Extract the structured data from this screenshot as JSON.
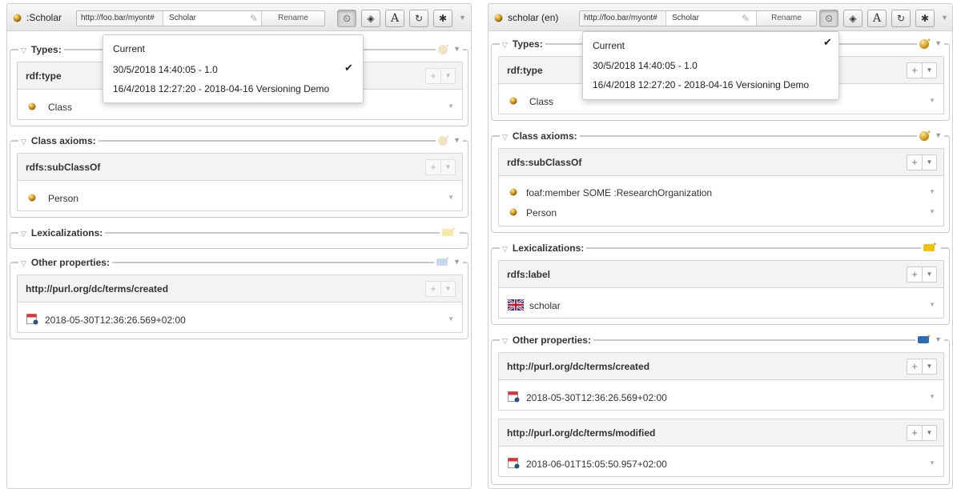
{
  "left": {
    "header": {
      "title": ":Scholar",
      "namespace": "http://foo.bar/myont#",
      "local_name": "Scholar",
      "rename_label": "Rename",
      "font_button": "A"
    },
    "history_menu": {
      "items": [
        {
          "label": "Current",
          "checked": false
        },
        {
          "label": "30/5/2018 14:40:05 - 1.0",
          "checked": true
        },
        {
          "label": "16/4/2018 12:27:20 - 2018-04-16 Versioning Demo",
          "checked": false
        }
      ]
    },
    "sections": {
      "types": {
        "title": "Types:",
        "property": "rdf:type",
        "values": [
          {
            "text": "Class"
          }
        ]
      },
      "class_axioms": {
        "title": "Class axioms:",
        "property": "rdfs:subClassOf",
        "values": [
          {
            "text": "Person"
          }
        ]
      },
      "lexicalizations": {
        "title": "Lexicalizations:"
      },
      "other_properties": {
        "title": "Other properties:",
        "properties": [
          {
            "name": "http://purl.org/dc/terms/created",
            "values": [
              {
                "text": "2018-05-30T12:36:26.569+02:00"
              }
            ]
          }
        ]
      }
    }
  },
  "right": {
    "header": {
      "title": "scholar (en)",
      "namespace": "http://foo.bar/myont#",
      "local_name": "Scholar",
      "rename_label": "Rename",
      "font_button": "A"
    },
    "history_menu": {
      "items": [
        {
          "label": "Current",
          "checked": true
        },
        {
          "label": "30/5/2018 14:40:05 - 1.0",
          "checked": false
        },
        {
          "label": "16/4/2018 12:27:20 - 2018-04-16 Versioning Demo",
          "checked": false
        }
      ]
    },
    "sections": {
      "types": {
        "title": "Types:",
        "property": "rdf:type",
        "values": [
          {
            "text": "Class"
          }
        ]
      },
      "class_axioms": {
        "title": "Class axioms:",
        "property": "rdfs:subClassOf",
        "values": [
          {
            "text": "foaf:member SOME :ResearchOrganization"
          },
          {
            "text": "Person"
          }
        ]
      },
      "lexicalizations": {
        "title": "Lexicalizations:",
        "property": "rdfs:label",
        "values": [
          {
            "text": "scholar",
            "flag": "uk-flag"
          }
        ]
      },
      "other_properties": {
        "title": "Other properties:",
        "properties": [
          {
            "name": "http://purl.org/dc/terms/created",
            "values": [
              {
                "text": "2018-05-30T12:36:26.569+02:00"
              }
            ]
          },
          {
            "name": "http://purl.org/dc/terms/modified",
            "values": [
              {
                "text": "2018-06-01T15:05:50.957+02:00"
              }
            ]
          }
        ]
      }
    }
  },
  "icons": {
    "resource": "class-ball-icon",
    "history": "history-icon",
    "hide_inferred": "eye-slash-icon",
    "font": "font-icon",
    "refresh": "refresh-icon",
    "settings": "gear-icon",
    "add": "plus-icon",
    "date": "calendar-icon"
  },
  "colors": {
    "class_ball": "#c8901a",
    "class_ball_faded": "#efe4c4",
    "folder_yellow": "#f3c20c",
    "folder_blue": "#2e6db4"
  }
}
